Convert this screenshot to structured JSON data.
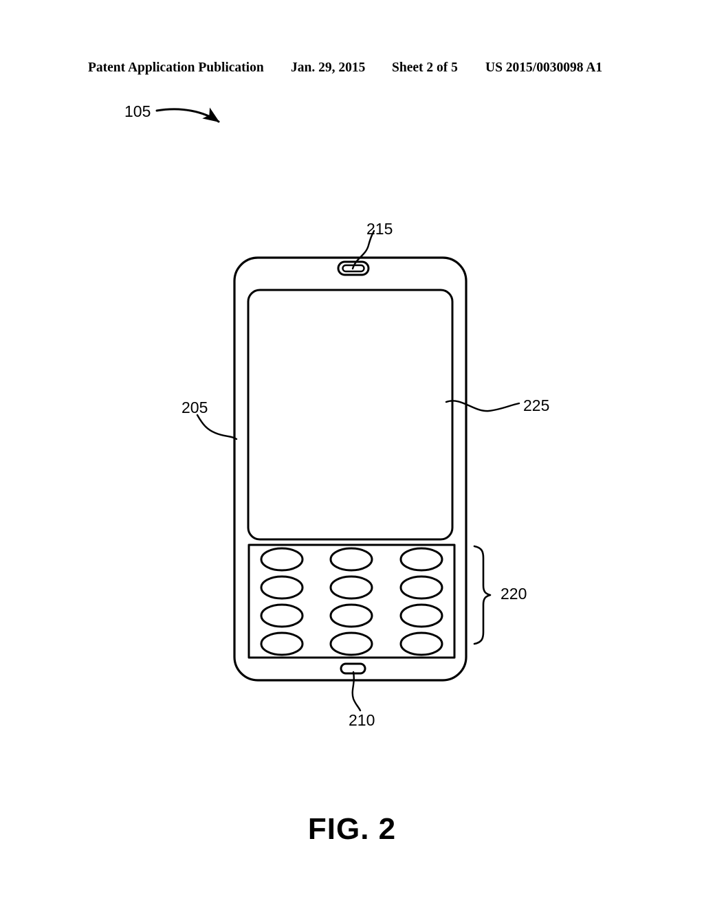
{
  "document": {
    "type": "patent-drawing-sheet",
    "header": {
      "publication": "Patent Application Publication",
      "date": "Jan. 29, 2015",
      "sheet": "Sheet 2 of 5",
      "publication_number": "US 2015/0030098 A1"
    },
    "figure_caption": "FIG. 2",
    "line_color": "#000000",
    "background_color": "#ffffff"
  },
  "figure": {
    "title": "FIG. 2",
    "subject": "mobile communication device",
    "reference_numerals": [
      {
        "id": "105",
        "label": "105",
        "points_to": "overall-system",
        "leader": "curved-arrow"
      },
      {
        "id": "215",
        "label": "215",
        "points_to": "earpiece-speaker",
        "leader": "curved-line"
      },
      {
        "id": "225",
        "label": "225",
        "points_to": "display-screen",
        "leader": "wavy-line"
      },
      {
        "id": "205",
        "label": "205",
        "points_to": "device-housing",
        "leader": "curved-line"
      },
      {
        "id": "220",
        "label": "220",
        "points_to": "keypad",
        "leader": "curly-brace"
      },
      {
        "id": "210",
        "label": "210",
        "points_to": "microphone",
        "leader": "curved-line"
      }
    ],
    "components": {
      "housing": {
        "name": "device-housing",
        "numeral": "205"
      },
      "speaker": {
        "name": "earpiece-speaker",
        "numeral": "215"
      },
      "display": {
        "name": "display-screen",
        "numeral": "225"
      },
      "keypad": {
        "name": "keypad",
        "numeral": "220",
        "rows": 4,
        "columns": 3,
        "key_count": 12,
        "key_shape": "ellipse"
      },
      "microphone": {
        "name": "microphone",
        "numeral": "210"
      }
    }
  }
}
